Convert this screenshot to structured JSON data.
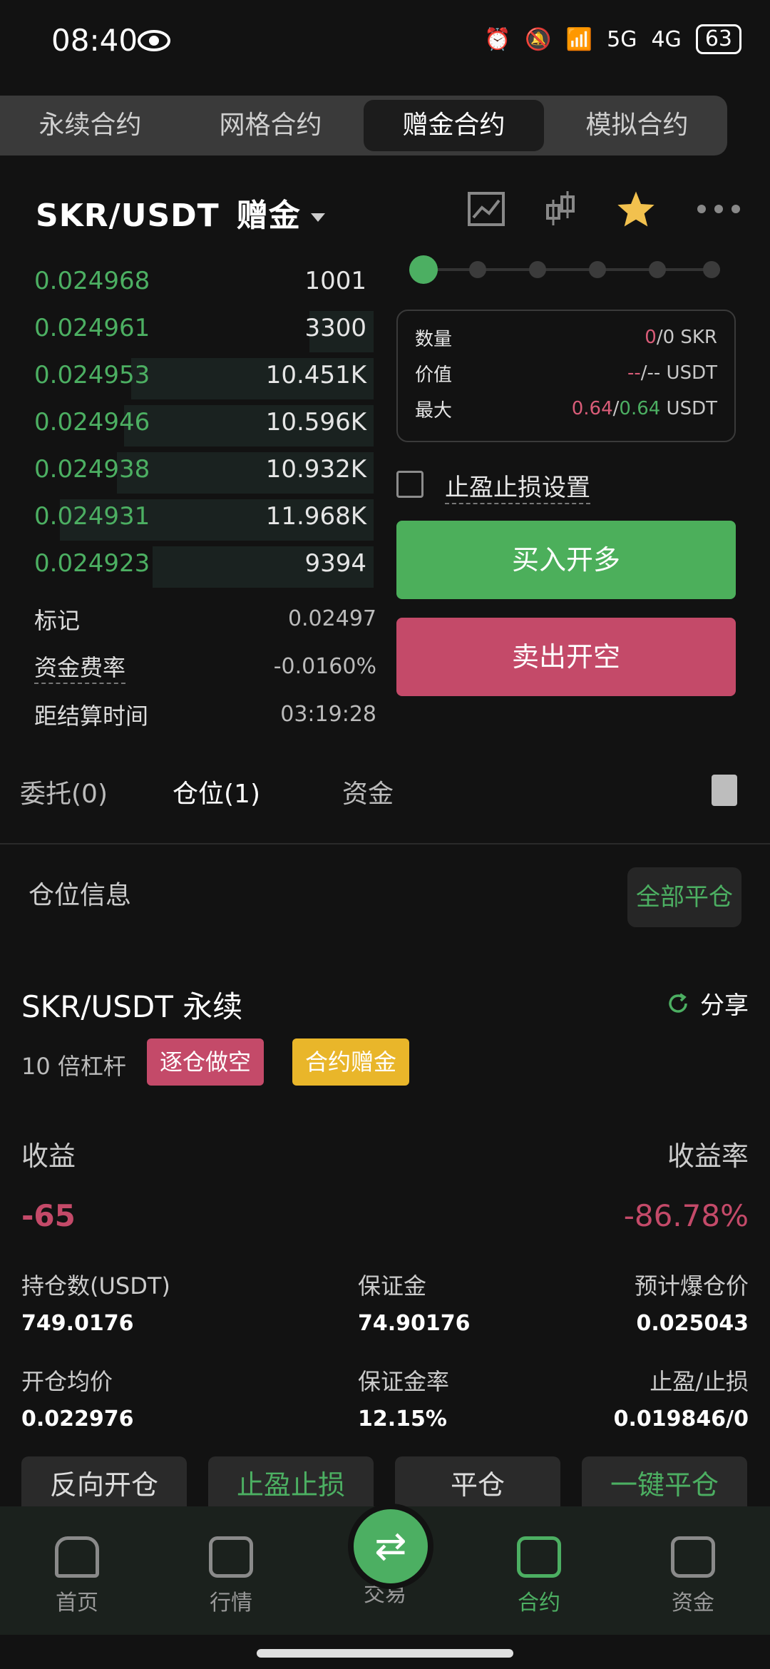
{
  "status": {
    "time": "08:40",
    "net5g": "5G",
    "net4g": "4G",
    "battery": "63"
  },
  "top_tabs": [
    "永续合约",
    "网格合约",
    "赠金合约",
    "模拟合约"
  ],
  "pair": {
    "symbol": "SKR/USDT",
    "mode": "赠金"
  },
  "order_book": [
    {
      "price": "0.024968",
      "qty": "1001",
      "depth": 0.0
    },
    {
      "price": "0.024961",
      "qty": "3300",
      "depth": 0.18
    },
    {
      "price": "0.024953",
      "qty": "10.451K",
      "depth": 0.68
    },
    {
      "price": "0.024946",
      "qty": "10.596K",
      "depth": 0.7
    },
    {
      "price": "0.024938",
      "qty": "10.932K",
      "depth": 0.72
    },
    {
      "price": "0.024931",
      "qty": "11.968K",
      "depth": 0.88
    },
    {
      "price": "0.024923",
      "qty": "9394",
      "depth": 0.62
    }
  ],
  "stats": {
    "mark_label": "标记",
    "mark_value": "0.02497",
    "funding_label": "资金费率",
    "funding_value": "-0.0160%",
    "settle_label": "距结算时间",
    "settle_value": "03:19:28"
  },
  "panel": {
    "qty_label": "数量",
    "qty_a": "0",
    "qty_b": "/0 SKR",
    "value_label": "价值",
    "value_a": "--",
    "value_b": "/-- USDT",
    "max_label": "最大",
    "max_a": "0.64",
    "max_b": "0.64",
    "max_unit": " USDT",
    "tpsl_label": "止盈止损设置",
    "buy_label": "买入开多",
    "sell_label": "卖出开空"
  },
  "pos_tabs": [
    "委托(0)",
    "仓位(1)",
    "资金"
  ],
  "position": {
    "section_title": "仓位信息",
    "close_all": "全部平仓",
    "title": "SKR/USDT 永续",
    "share": "分享",
    "leverage": "10 倍杠杆",
    "badge1": "逐仓做空",
    "badge2": "合约赠金",
    "pnl_label": "收益",
    "roe_label": "收益率",
    "pnl": "-65",
    "roe": "-86.78%",
    "fields": [
      {
        "label": "持仓数(USDT)",
        "value": "749.0176"
      },
      {
        "label": "保证金",
        "value": "74.90176"
      },
      {
        "label": "预计爆仓价",
        "value": "0.025043"
      },
      {
        "label": "开仓均价",
        "value": "0.022976"
      },
      {
        "label": "保证金率",
        "value": "12.15%"
      },
      {
        "label": "止盈/止损",
        "value": "0.019846/0"
      }
    ],
    "actions": [
      "反向开仓",
      "止盈止损",
      "平仓",
      "一键平仓"
    ]
  },
  "nav": [
    "首页",
    "行情",
    "交易",
    "合约",
    "资金"
  ],
  "colors": {
    "green": "#4caf62",
    "red": "#c44a69",
    "yellow": "#e9b62a"
  }
}
